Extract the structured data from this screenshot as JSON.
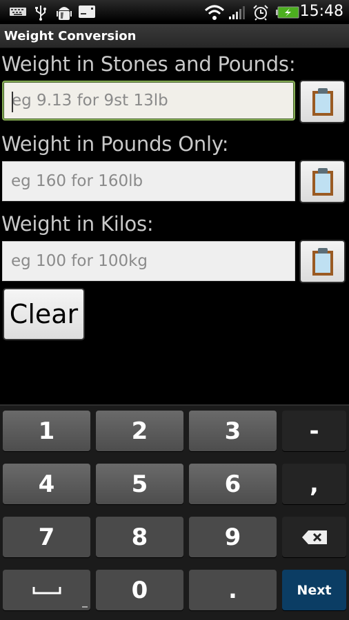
{
  "status_bar": {
    "left_icons": [
      "keyboard-icon",
      "usb-icon",
      "android-debug-icon",
      "sd-card-icon"
    ],
    "right_icons": [
      "wifi-icon",
      "signal-icon",
      "alarm-icon",
      "battery-charging-icon"
    ],
    "time": "15:48",
    "battery_color": "#4caf1f"
  },
  "app": {
    "title": "Weight Conversion"
  },
  "form": {
    "stones": {
      "label": "Weight in Stones and Pounds:",
      "placeholder": "eg 9.13 for 9st 13lb",
      "value": ""
    },
    "pounds": {
      "label": "Weight in Pounds Only:",
      "placeholder": "eg 160 for 160lb",
      "value": ""
    },
    "kilos": {
      "label": "Weight in Kilos:",
      "placeholder": "eg 100 for 100kg",
      "value": ""
    },
    "paste_icon": "clipboard-icon",
    "clear_label": "Clear",
    "focus_color": "#86ad55"
  },
  "keyboard": {
    "rows": [
      [
        "1",
        "2",
        "3",
        "-"
      ],
      [
        "4",
        "5",
        "6",
        ","
      ],
      [
        "7",
        "8",
        "9",
        "⌫"
      ],
      [
        "␣",
        "0",
        ".",
        "Next"
      ]
    ],
    "next_label": "Next",
    "next_color": "#0b3d64"
  }
}
